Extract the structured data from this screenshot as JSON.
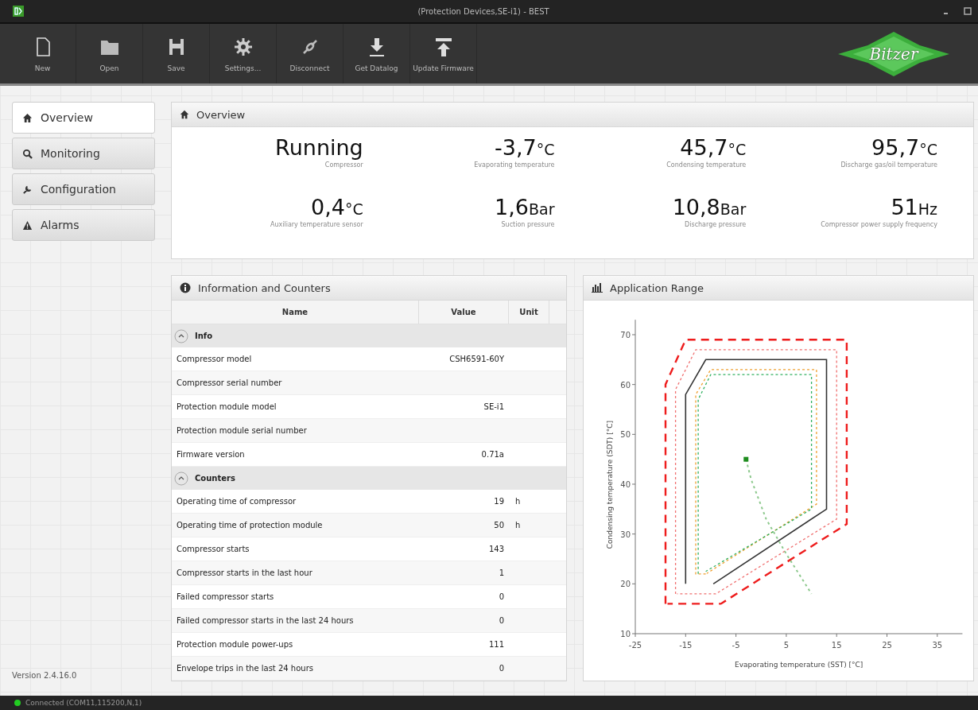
{
  "window": {
    "title": "(Protection Devices,SE-i1) - BEST"
  },
  "toolbar": [
    {
      "label": "New"
    },
    {
      "label": "Open"
    },
    {
      "label": "Save"
    },
    {
      "label": "Settings..."
    },
    {
      "label": "Disconnect"
    },
    {
      "label": "Get Datalog"
    },
    {
      "label": "Update Firmware"
    }
  ],
  "logo": {
    "text": "Bitzer"
  },
  "nav": [
    {
      "label": "Overview",
      "selected": true
    },
    {
      "label": "Monitoring",
      "selected": false
    },
    {
      "label": "Configuration",
      "selected": false
    },
    {
      "label": "Alarms",
      "selected": false
    }
  ],
  "version": "Version 2.4.16.0",
  "overview": {
    "title": "Overview",
    "metrics": [
      {
        "value": "Running",
        "label": "Compressor"
      },
      {
        "value": "-3,7",
        "unit": "°C",
        "label": "Evaporating temperature"
      },
      {
        "value": "45,7",
        "unit": "°C",
        "label": "Condensing temperature"
      },
      {
        "value": "95,7",
        "unit": "°C",
        "label": "Discharge gas/oil temperature"
      },
      {
        "value": "0,4",
        "unit": "°C",
        "label": "Auxiliary temperature sensor"
      },
      {
        "value": "1,6",
        "unit": "Bar",
        "label": "Suction pressure"
      },
      {
        "value": "10,8",
        "unit": "Bar",
        "label": "Discharge pressure"
      },
      {
        "value": "51",
        "unit": "Hz",
        "label": "Compressor power supply frequency"
      }
    ]
  },
  "info": {
    "title": "Information and Counters",
    "columns": [
      "Name",
      "Value",
      "Unit"
    ],
    "groups": [
      {
        "name": "Info",
        "expanded": true,
        "rows": [
          {
            "name": "Compressor model",
            "value": "CSH6591-60Y"
          },
          {
            "name": "Compressor serial number"
          },
          {
            "name": "Protection module model",
            "value": "SE-i1"
          },
          {
            "name": "Protection module serial number"
          },
          {
            "name": "Firmware version",
            "value": "0.71a"
          }
        ]
      },
      {
        "name": "Counters",
        "expanded": true,
        "rows": [
          {
            "name": "Operating time of compressor",
            "value": "19",
            "unit": "h"
          },
          {
            "name": "Operating time of protection module",
            "value": "50",
            "unit": "h"
          },
          {
            "name": "Compressor starts",
            "value": "143"
          },
          {
            "name": "Compressor starts in the last hour",
            "value": "1"
          },
          {
            "name": "Failed compressor starts",
            "value": "0"
          },
          {
            "name": "Failed compressor starts in the last 24 hours",
            "value": "0"
          },
          {
            "name": "Protection module power-ups",
            "value": "111"
          },
          {
            "name": "Envelope trips in the last 24 hours",
            "value": "0"
          }
        ]
      }
    ]
  },
  "range": {
    "title": "Application Range",
    "chart_data": {
      "type": "line",
      "xlabel": "Evaporating temperature (SST) [°C]",
      "ylabel": "Condensing temperature (SDT) [°C]",
      "xlim": [
        -25,
        40
      ],
      "ylim": [
        10,
        73
      ],
      "xticks": [
        -25,
        -15,
        -5,
        5,
        15,
        25,
        35
      ],
      "yticks": [
        10,
        20,
        30,
        40,
        50,
        60,
        70
      ],
      "series": [
        {
          "color": "#ee1c1c",
          "line_style": "dashed",
          "x": [
            -19,
            -19,
            -15,
            17,
            17,
            -8,
            -18.6
          ],
          "values": [
            16,
            60,
            69,
            69,
            32,
            16,
            16
          ]
        },
        {
          "color": "#f07070",
          "line_style": "dotted",
          "x": [
            -17,
            -17,
            -13,
            15,
            15,
            -9,
            -16.7
          ],
          "values": [
            18,
            59,
            67,
            67,
            33,
            18,
            18
          ]
        },
        {
          "color": "#333333",
          "line_style": "solid",
          "x": [
            -15,
            -15,
            -11,
            13,
            13,
            -9.5
          ],
          "values": [
            20,
            58,
            65,
            65,
            35,
            20
          ]
        },
        {
          "color": "#f0a030",
          "line_style": "dotted",
          "x": [
            -11,
            -13,
            -13,
            -10,
            11,
            11,
            -10.8
          ],
          "values": [
            22,
            22,
            58,
            63,
            63,
            36,
            22.1
          ]
        },
        {
          "color": "#30b060",
          "line_style": "dotted",
          "x": [
            -12.5,
            -12.5,
            -10,
            10,
            10,
            -11
          ],
          "values": [
            22,
            57,
            62,
            62,
            35,
            22.5
          ]
        },
        {
          "color": "#8cc88c",
          "line_style": "dashed",
          "x": [
            -3,
            -2,
            1,
            5,
            10
          ],
          "values": [
            45,
            41,
            33,
            26,
            18
          ]
        },
        {
          "color": "#1e8c1e",
          "marker": "square",
          "x": [
            -3
          ],
          "values": [
            45
          ]
        }
      ]
    }
  },
  "status": {
    "text": "Connected (COM11,115200,N,1)",
    "connected": true
  }
}
